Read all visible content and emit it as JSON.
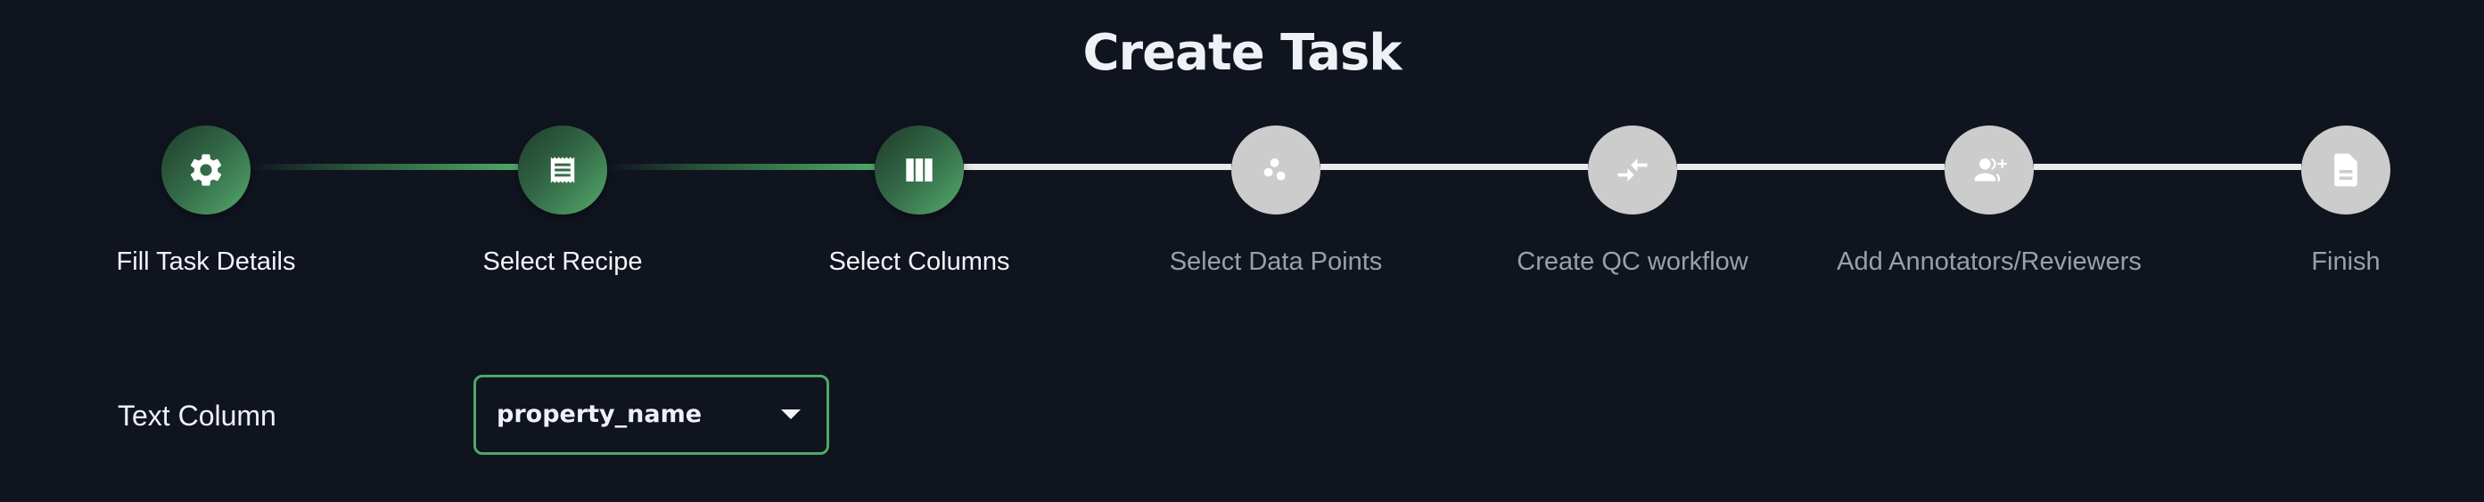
{
  "page": {
    "title": "Create Task"
  },
  "stepper": {
    "current_step_index": 2,
    "completed_color": "#4ea866",
    "pending_color": "#cccccc",
    "steps": [
      {
        "label": "Fill Task Details",
        "icon": "gear-icon",
        "status": "done"
      },
      {
        "label": "Select Recipe",
        "icon": "receipt-icon",
        "status": "done"
      },
      {
        "label": "Select Columns",
        "icon": "view-columns-icon",
        "status": "done"
      },
      {
        "label": "Select Data Points",
        "icon": "scatter-dots-icon",
        "status": "pending"
      },
      {
        "label": "Create QC workflow",
        "icon": "compare-arrows-icon",
        "status": "pending"
      },
      {
        "label": "Add Annotators/Reviewers",
        "icon": "group-add-icon",
        "status": "pending"
      },
      {
        "label": "Finish",
        "icon": "document-icon",
        "status": "pending"
      }
    ]
  },
  "form": {
    "text_column": {
      "label": "Text Column",
      "selected_value": "property_name"
    }
  }
}
